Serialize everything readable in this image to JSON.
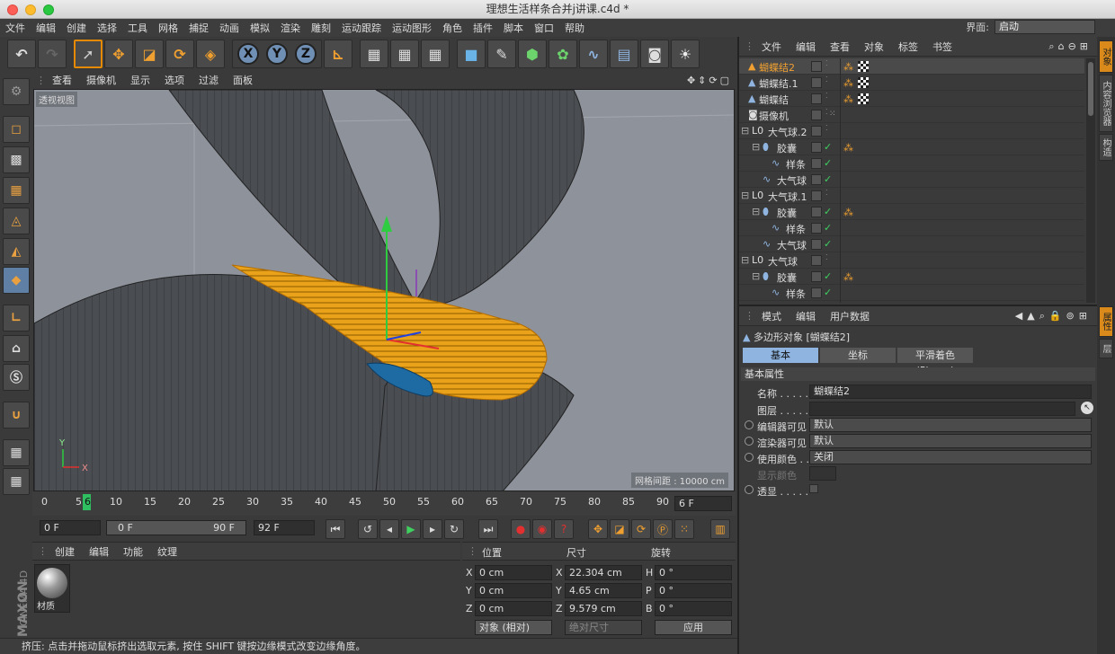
{
  "window": {
    "title": "理想生活样条合并j讲课.c4d *"
  },
  "menu": [
    "文件",
    "编辑",
    "创建",
    "选择",
    "工具",
    "网格",
    "捕捉",
    "动画",
    "模拟",
    "渲染",
    "雕刻",
    "运动跟踪",
    "运动图形",
    "角色",
    "插件",
    "脚本",
    "窗口",
    "帮助"
  ],
  "interface": {
    "label": "界面:",
    "value": "启动"
  },
  "viewport": {
    "menu": [
      "查看",
      "摄像机",
      "显示",
      "选项",
      "过滤",
      "面板"
    ],
    "name": "透视视图",
    "grid_label": "网格间距 : 10000 cm",
    "axis_y": "Y",
    "axis_x": "X"
  },
  "timeline": {
    "ticks": [
      "0",
      "5",
      "6",
      "10",
      "15",
      "20",
      "25",
      "30",
      "35",
      "40",
      "45",
      "50",
      "55",
      "60",
      "65",
      "70",
      "75",
      "80",
      "85",
      "90"
    ],
    "current_frame": "6 F"
  },
  "transport": {
    "start": "0 F",
    "range_start": "0 F",
    "range_end": "90 F",
    "end": "92 F"
  },
  "materials": {
    "menu": [
      "创建",
      "编辑",
      "功能",
      "纹理"
    ],
    "items": [
      {
        "name": "材质"
      }
    ]
  },
  "coords": {
    "headers": {
      "position": "位置",
      "size": "尺寸",
      "rotation": "旋转"
    },
    "rows": [
      {
        "axis": "X",
        "pos": "0 cm",
        "size_axis": "X",
        "size": "22.304 cm",
        "rot_axis": "H",
        "rot": "0 °"
      },
      {
        "axis": "Y",
        "pos": "0 cm",
        "size_axis": "Y",
        "size": "4.65 cm",
        "rot_axis": "P",
        "rot": "0 °"
      },
      {
        "axis": "Z",
        "pos": "0 cm",
        "size_axis": "Z",
        "size": "9.579 cm",
        "rot_axis": "B",
        "rot": "0 °"
      }
    ],
    "mode": "对象 (相对)",
    "size_mode": "绝对尺寸",
    "apply": "应用"
  },
  "status": "挤压: 点击并拖动鼠标挤出选取元素, 按住 SHIFT 键按边缘模式改变边缘角度。",
  "objects": {
    "menu": [
      "文件",
      "编辑",
      "查看",
      "对象",
      "标签",
      "书签"
    ],
    "rows": [
      {
        "name": "蝴蝶结2",
        "indent": 0,
        "selected": true
      },
      {
        "name": "蝴蝶结.1",
        "indent": 0
      },
      {
        "name": "蝴蝶结",
        "indent": 0
      },
      {
        "name": "摄像机",
        "indent": 0
      },
      {
        "name": "大气球.2",
        "indent": 0
      },
      {
        "name": "胶囊",
        "indent": 1
      },
      {
        "name": "样条",
        "indent": 2
      },
      {
        "name": "大气球",
        "indent": 1
      },
      {
        "name": "大气球.1",
        "indent": 0
      },
      {
        "name": "胶囊",
        "indent": 1
      },
      {
        "name": "样条",
        "indent": 2
      },
      {
        "name": "大气球",
        "indent": 1
      },
      {
        "name": "大气球",
        "indent": 0
      },
      {
        "name": "胶囊",
        "indent": 1
      },
      {
        "name": "样条",
        "indent": 2
      }
    ]
  },
  "attributes": {
    "menu": [
      "模式",
      "编辑",
      "用户数据"
    ],
    "object_title": "多边形对象 [蝴蝶结2]",
    "tabs": [
      "基本",
      "坐标",
      "平滑着色(Phong)"
    ],
    "section": "基本属性",
    "fields": [
      {
        "label": "名称 . . . . .",
        "value": "蝴蝶结2"
      },
      {
        "label": "图层 . . . . .",
        "value": ""
      },
      {
        "label": "编辑器可见",
        "value": "默认"
      },
      {
        "label": "渲染器可见",
        "value": "默认"
      },
      {
        "label": "使用颜色 . .",
        "value": "关闭"
      },
      {
        "label": "显示颜色",
        "value": ""
      },
      {
        "label": "透显 . . . . .",
        "value": ""
      }
    ]
  },
  "side_tabs": [
    "对象",
    "内容浏览器",
    "构造",
    "属性",
    "层"
  ],
  "brand": {
    "line1": "MAXON",
    "line2": "CINEMA 4D"
  }
}
